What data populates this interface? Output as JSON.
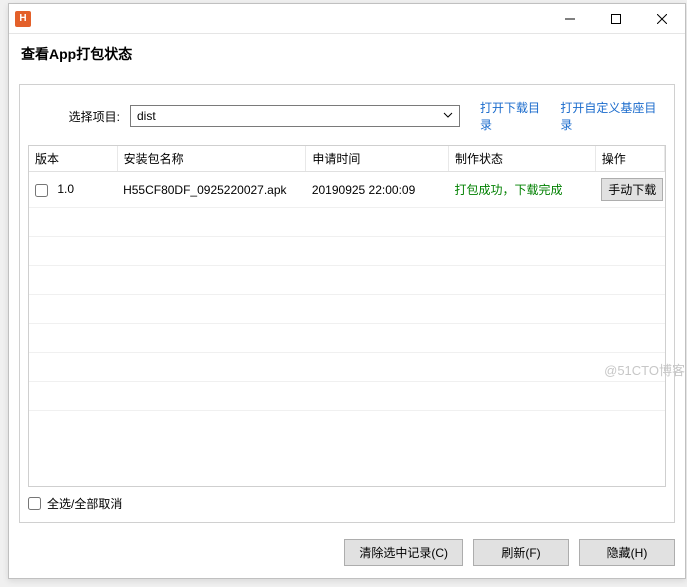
{
  "titlebar": {
    "icon_letter": "H"
  },
  "subtitle": "查看App打包状态",
  "filter": {
    "label": "选择项目:",
    "selected": "dist"
  },
  "links": {
    "open_download_dir": "打开下载目录",
    "open_custom_base_dir": "打开自定义基座目录"
  },
  "table": {
    "headers": {
      "version": "版本",
      "package": "安装包名称",
      "apply_time": "申请时间",
      "status": "制作状态",
      "action": "操作"
    },
    "rows": [
      {
        "version": "1.0",
        "package": "H55CF80DF_0925220027.apk",
        "apply_time": "20190925 22:00:09",
        "status": "打包成功，下载完成",
        "action_label": "手动下载"
      }
    ]
  },
  "select_all": "全选/全部取消",
  "buttons": {
    "clear_selected": "清除选中记录(C)",
    "refresh": "刷新(F)",
    "hide": "隐藏(H)"
  },
  "watermark": "@51CTO博客"
}
